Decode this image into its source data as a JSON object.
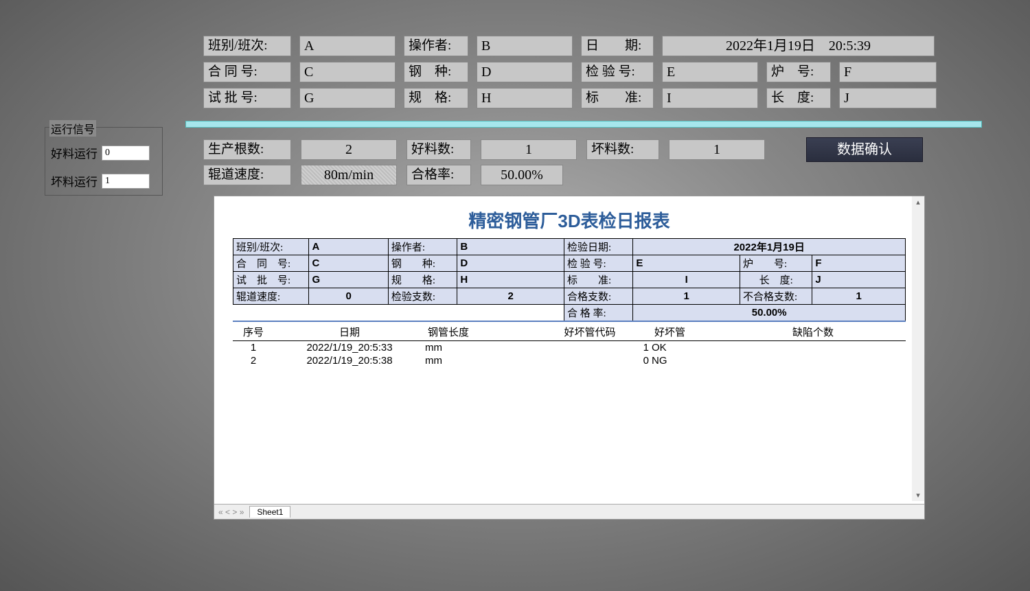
{
  "signal": {
    "legend": "运行信号",
    "good_label": "好料运行",
    "good_val": "0",
    "bad_label": "坏料运行",
    "bad_val": "1"
  },
  "form": {
    "shift_label": "班别/班次:",
    "shift_val": "A",
    "operator_label": "操作者:",
    "operator_val": "B",
    "date_label": "日　　期:",
    "date_val": "2022年1月19日　20:5:39",
    "contract_label": "合 同 号:",
    "contract_val": "C",
    "steel_label": "钢　种:",
    "steel_val": "D",
    "inspect_label": "检 验 号:",
    "inspect_val": "E",
    "furnace_label": "炉　号:",
    "furnace_val": "F",
    "batch_label": "试 批 号:",
    "batch_val": "G",
    "spec_label": "规　格:",
    "spec_val": "H",
    "std_label": "标　　准:",
    "std_val": "I",
    "length_label": "长　度:",
    "length_val": "J"
  },
  "stats": {
    "produce_label": "生产根数:",
    "produce_val": "2",
    "good_label": "好料数:",
    "good_val": "1",
    "bad_label": "坏料数:",
    "bad_val": "1",
    "confirm_btn": "数据确认",
    "speed_label": "辊道速度:",
    "speed_val": "80m/min",
    "rate_label": "合格率:",
    "rate_val": "50.00%"
  },
  "report": {
    "title": "精密钢管厂3D表检日报表",
    "hdr": {
      "shift_l": "班别/班次:",
      "shift_v": "A",
      "op_l": "操作者:",
      "op_v": "B",
      "idate_l": "检验日期:",
      "idate_v": "2022年1月19日",
      "contract_l": "合　同　号:",
      "contract_v": "C",
      "steel_l": "钢　　种:",
      "steel_v": "D",
      "ino_l": "检 验 号:",
      "ino_v": "E",
      "furnace_l": "炉　　号:",
      "furnace_v": "F",
      "batch_l": "试　批　号:",
      "batch_v": "G",
      "spec_l": "规　　格:",
      "spec_v": "H",
      "std_l": "标　　准:",
      "std_v": "I",
      "len_l": "长　度:",
      "len_v": "J",
      "speed_l": "辊道速度:",
      "speed_v": "0",
      "icount_l": "检验支数:",
      "icount_v": "2",
      "ok_l": "合格支数:",
      "ok_v": "1",
      "ng_l": "不合格支数:",
      "ng_v": "1",
      "rate_l": "合 格 率:",
      "rate_v": "50.00%"
    },
    "cols": {
      "seq": "序号",
      "date": "日期",
      "len": "钢管长度",
      "code": "好坏管代码",
      "pipe": "好坏管",
      "def": "缺陷个数"
    },
    "rows": [
      {
        "seq": "1",
        "date": "2022/1/19_20:5:33",
        "len": "mm",
        "code": "1",
        "pipe": "OK",
        "def": ""
      },
      {
        "seq": "2",
        "date": "2022/1/19_20:5:38",
        "len": "mm",
        "code": "0",
        "pipe": "NG",
        "def": ""
      }
    ],
    "sheet_tab": "Sheet1",
    "nav": "« <  >  »"
  }
}
